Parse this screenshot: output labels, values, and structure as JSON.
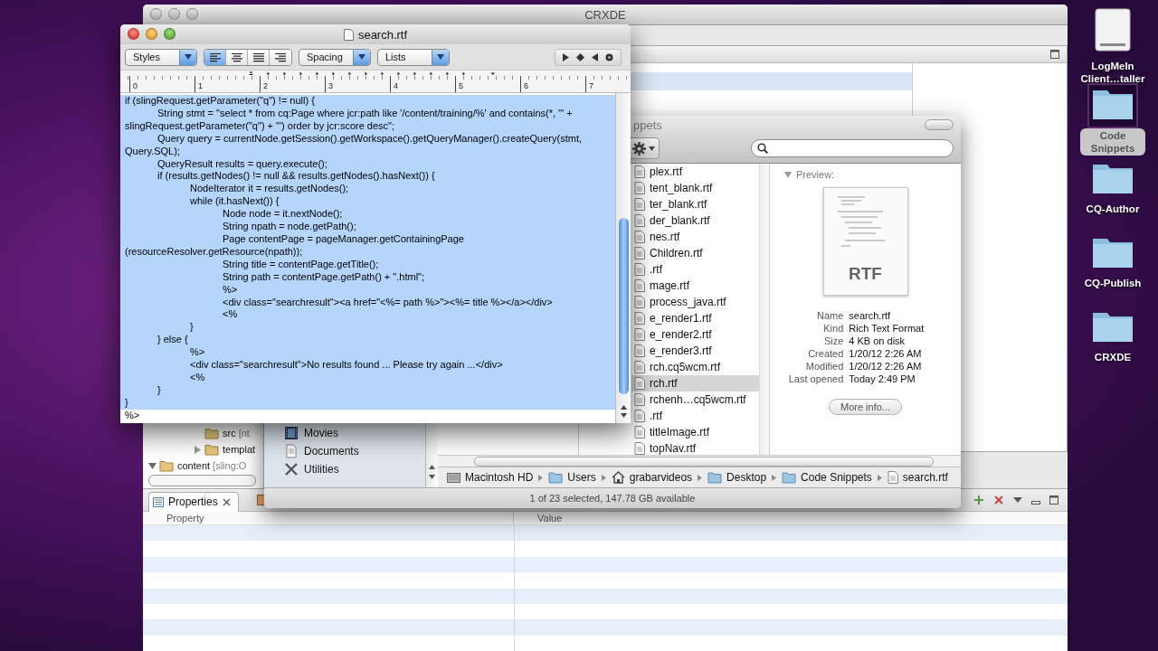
{
  "crxde": {
    "title": "CRXDE",
    "tree": [
      {
        "children": [
          {
            "label": "src",
            "detail": "[nt"
          },
          {
            "label": "templat",
            "expanded": false
          }
        ]
      },
      {
        "label": "content",
        "detail": "[sling:O",
        "expanded": true
      }
    ],
    "properties_tab": "Properties",
    "columns": [
      "Property",
      "Value"
    ]
  },
  "finder": {
    "title": "ppets",
    "sidebar": [
      {
        "label": "Movies",
        "kind": "movies"
      },
      {
        "label": "Documents",
        "kind": "documents"
      },
      {
        "label": "Utilities",
        "kind": "utilities"
      }
    ],
    "files": [
      {
        "name": "plex.rtf",
        "selected": false
      },
      {
        "name": "tent_blank.rtf",
        "selected": false
      },
      {
        "name": "ter_blank.rtf",
        "selected": false
      },
      {
        "name": "der_blank.rtf",
        "selected": false
      },
      {
        "name": "nes.rtf",
        "selected": false
      },
      {
        "name": "Children.rtf",
        "selected": false
      },
      {
        "name": ".rtf",
        "selected": false
      },
      {
        "name": "mage.rtf",
        "selected": false
      },
      {
        "name": "process_java.rtf",
        "selected": false
      },
      {
        "name": "e_render1.rtf",
        "selected": false
      },
      {
        "name": "e_render2.rtf",
        "selected": false
      },
      {
        "name": "e_render3.rtf",
        "selected": false
      },
      {
        "name": "rch.cq5wcm.rtf",
        "selected": false
      },
      {
        "name": "rch.rtf",
        "selected": true
      },
      {
        "name": "rchenh…cq5wcm.rtf",
        "selected": false
      },
      {
        "name": ".rtf",
        "selected": false
      },
      {
        "name": "titleImage.rtf",
        "selected": false
      },
      {
        "name": "topNav.rtf",
        "selected": false
      }
    ],
    "preview": {
      "heading": "Preview:",
      "badge": "RTF",
      "button": "More info...",
      "info": [
        {
          "label": "Name",
          "value": "search.rtf"
        },
        {
          "label": "Kind",
          "value": "Rich Text Format"
        },
        {
          "label": "Size",
          "value": "4 KB on disk"
        },
        {
          "label": "Created",
          "value": "1/20/12 2:26 AM"
        },
        {
          "label": "Modified",
          "value": "1/20/12 2:26 AM"
        },
        {
          "label": "Last opened",
          "value": "Today 2:49 PM"
        }
      ]
    },
    "path": [
      {
        "label": "Macintosh HD",
        "kind": "disk"
      },
      {
        "label": "Users",
        "kind": "folder"
      },
      {
        "label": "grabarvideos",
        "kind": "home"
      },
      {
        "label": "Desktop",
        "kind": "folder"
      },
      {
        "label": "Code Snippets",
        "kind": "folder"
      },
      {
        "label": "search.rtf",
        "kind": "file"
      }
    ],
    "status": "1 of 23 selected, 147.78 GB available"
  },
  "textedit": {
    "title": "search.rtf",
    "styles": "Styles",
    "spacing": "Spacing",
    "lists": "Lists",
    "alignments": [
      {
        "kind": "left",
        "selected": true
      },
      {
        "kind": "center",
        "selected": false
      },
      {
        "kind": "justify",
        "selected": false
      },
      {
        "kind": "right",
        "selected": false
      }
    ],
    "ruler": [
      "0",
      "1",
      "2",
      "3",
      "4",
      "5",
      "6",
      "7"
    ],
    "lines": [
      {
        "text": "if (slingRequest.getParameter(\"q\") != null) {",
        "selected": true
      },
      {
        "text": "\tString stmt = \"select * from cq:Page where jcr:path like '/content/training/%' and contains(*, '\" + slingRequest.getParameter(\"q\") + \"') order by jcr:score desc\";",
        "selected": true
      },
      {
        "text": "\tQuery query = currentNode.getSession().getWorkspace().getQueryManager().createQuery(stmt, Query.SQL);",
        "selected": true
      },
      {
        "text": "\tQueryResult results = query.execute();",
        "selected": true
      },
      {
        "text": "\tif (results.getNodes() != null && results.getNodes().hasNext()) {",
        "selected": true
      },
      {
        "text": "\t\tNodeIterator it = results.getNodes();",
        "selected": true
      },
      {
        "text": "\t\twhile (it.hasNext()) {",
        "selected": true
      },
      {
        "text": "\t\t\tNode node = it.nextNode();",
        "selected": true
      },
      {
        "text": "\t\t\tString npath = node.getPath();",
        "selected": true
      },
      {
        "text": "\t\t\tPage contentPage = pageManager.getContainingPage (resourceResolver.getResource(npath));",
        "selected": true
      },
      {
        "text": "\t\t\tString title = contentPage.getTitle();",
        "selected": true
      },
      {
        "text": "\t\t\tString path = contentPage.getPath() + \".html\";",
        "selected": true
      },
      {
        "text": "\t\t\t%>",
        "selected": true
      },
      {
        "text": "\t\t\t<div class=\"searchresult\"><a href=\"<%= path %>\"><%= title %></a></div>",
        "selected": true
      },
      {
        "text": "\t\t\t<%",
        "selected": true
      },
      {
        "text": "\t\t}",
        "selected": true
      },
      {
        "text": "\t} else {",
        "selected": true
      },
      {
        "text": "\t\t%>",
        "selected": true
      },
      {
        "text": "\t\t<div class=\"searchresult\">No results found ... Please try again ...</div>",
        "selected": true
      },
      {
        "text": "\t\t<%",
        "selected": true
      },
      {
        "text": "\t}",
        "selected": true
      },
      {
        "text": "}",
        "selected": true
      },
      {
        "text": "%>",
        "selected": false
      }
    ]
  },
  "desktop_icons": [
    {
      "label": "LogMeIn Client…taller",
      "kind": "drive",
      "selected": false
    },
    {
      "label": "Code Snippets",
      "kind": "folder",
      "selected": true
    },
    {
      "label": "CQ-Author",
      "kind": "folder",
      "selected": false
    },
    {
      "label": "CQ-Publish",
      "kind": "folder",
      "selected": false
    },
    {
      "label": "CRXDE",
      "kind": "folder",
      "selected": false
    }
  ]
}
